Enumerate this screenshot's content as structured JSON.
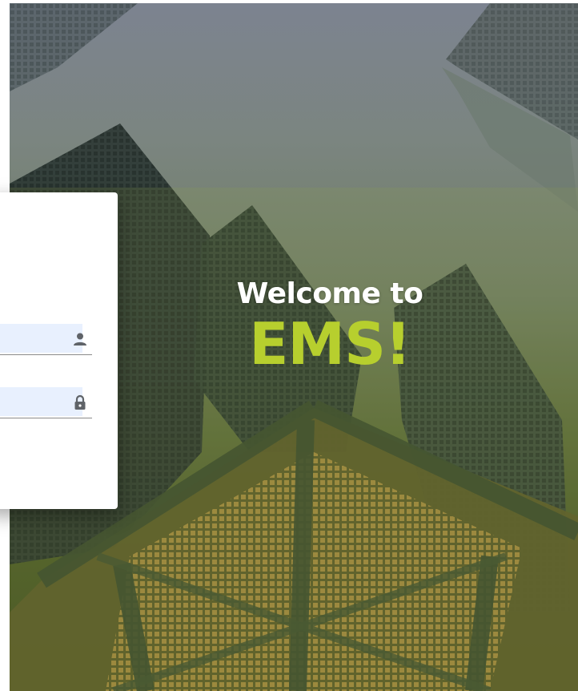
{
  "hero": {
    "welcome_text": "Welcome to",
    "brand_text": "EMS!",
    "brand_color": "#b7cf2e"
  },
  "login": {
    "username": {
      "value": "",
      "icon": "user-icon"
    },
    "password": {
      "value": "",
      "icon": "lock-icon"
    }
  }
}
